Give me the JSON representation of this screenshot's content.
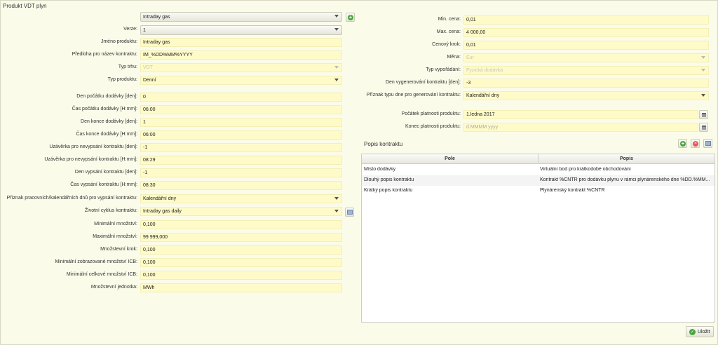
{
  "title": "Produkt VDT plyn",
  "left": {
    "product": "Intraday gas",
    "version_label": "Verze:",
    "version": "1",
    "fields": [
      {
        "label": "Jméno produktu:",
        "value": "Intraday gas"
      },
      {
        "label": "Předloha pro název kontraktu:",
        "value": "IM_%DD%MM%YYYY"
      },
      {
        "label": "Typ trhu:",
        "value": "VDT"
      },
      {
        "label": "Typ produktu:",
        "value": "Denní"
      },
      {
        "label": "Den počátku dodávky [den]:",
        "value": "0"
      },
      {
        "label": "Čas počátku dodávky [H:mm]:",
        "value": "06:00"
      },
      {
        "label": "Den konce dodávky [den]:",
        "value": "1"
      },
      {
        "label": "Čas konce dodávky [H:mm]:",
        "value": "06:00"
      },
      {
        "label": "Uzávěrka pro nevypsání kontraktu [den]:",
        "value": "-1"
      },
      {
        "label": "Uzávěrka pro nevypsání kontraktu [H:mm]:",
        "value": "08:29"
      },
      {
        "label": "Den vypsání kontraktu [den]:",
        "value": "-1"
      },
      {
        "label": "Čas vypsání kontraktu [H:mm]:",
        "value": "08:30"
      },
      {
        "label": "Příznak pracovních/kalendářních dnů pro vypsání kontraktu:",
        "value": "Kalendářní dny"
      },
      {
        "label": "Životní cyklus kontraktu:",
        "value": "Intraday gas daily"
      },
      {
        "label": "Minimální množství:",
        "value": "0,100"
      },
      {
        "label": "Maximální množství:",
        "value": "99 999,000"
      },
      {
        "label": "Množstevní krok:",
        "value": "0,100"
      },
      {
        "label": "Minimální zobrazované množství ICB:",
        "value": "0,100"
      },
      {
        "label": "Minimální celkové množství ICB:",
        "value": "0,100"
      },
      {
        "label": "Množstevní jednotka:",
        "value": "MWh"
      }
    ]
  },
  "right": {
    "fields": [
      {
        "label": "Min. cena:",
        "value": "0,01"
      },
      {
        "label": "Max. cena:",
        "value": "4 000,00"
      },
      {
        "label": "Cenový krok:",
        "value": "0,01"
      },
      {
        "label": "Měna:",
        "value": "Eur"
      },
      {
        "label": "Typ vypořádání:",
        "value": "Fyzická dodávka"
      },
      {
        "label": "Den vygenerování kontraktu [den]:",
        "value": "-3"
      },
      {
        "label": "Příznak typu dne pro generování kontraktu:",
        "value": "Kalendářní dny"
      }
    ],
    "validity_start_label": "Počátek platnosti produktu:",
    "validity_start": "1.ledna 2017",
    "validity_end_label": "Konec platnosti produktu:",
    "validity_end_placeholder": "d.MMMM yyyy"
  },
  "contract_desc": {
    "title": "Popis kontraktu",
    "columns": [
      "Pole",
      "Popis"
    ],
    "rows": [
      [
        "Místo dodávky",
        "Virtuální bod pro krátkodobé obchodování"
      ],
      [
        "Dlouhý popis kontraktu",
        "Kontrakt %CNTR pro dodávku plynu v rámci plynárenského dne %DD.%MM..."
      ],
      [
        "Krátký popis kontraktu",
        "Plynárenský kontrakt %CNTR"
      ]
    ]
  },
  "save_label": "Uložit",
  "icons": {
    "add": "green-plus-icon",
    "delete": "red-x-icon",
    "calendar": "calendar-icon",
    "edit": "edit-icon"
  },
  "colors": {
    "background": "#fbfbe9",
    "field": "#fefbc9"
  }
}
